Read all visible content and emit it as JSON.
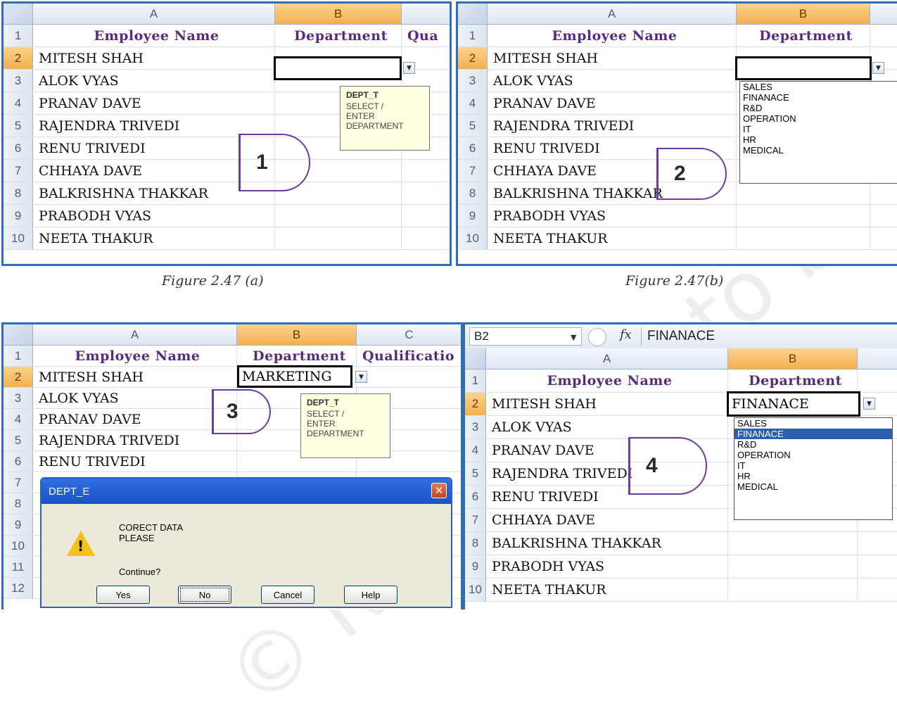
{
  "columns": {
    "a": "A",
    "b": "B",
    "c": "C"
  },
  "headers": {
    "employee_name": "Employee Name",
    "department": "Department",
    "qualification_a": "Qua",
    "qualification_c": "Qualificatio"
  },
  "row_numbers": [
    "1",
    "2",
    "3",
    "4",
    "5",
    "6",
    "7",
    "8",
    "9",
    "10",
    "11",
    "12"
  ],
  "employees": [
    "MITESH SHAH",
    "ALOK VYAS",
    "PRANAV DAVE",
    "RAJENDRA TRIVEDI",
    "RENU TRIVEDI",
    "CHHAYA DAVE",
    "BALKRISHNA THAKKAR",
    "PRABODH VYAS",
    "NEETA THAKUR"
  ],
  "tooltip": {
    "title": "DEPT_T",
    "line1": "SELECT /",
    "line2": "ENTER",
    "line3": "DEPARTMENT"
  },
  "dropdown_options": [
    "SALES",
    "FINANACE",
    "R&D",
    "OPERATION",
    "IT",
    "HR",
    "MEDICAL"
  ],
  "panel3": {
    "cell_value": "MARKETING",
    "partial_row6": "RENU TRIVEDI"
  },
  "dialog": {
    "title": "DEPT_E",
    "message1": "CORECT DATA",
    "message2": "PLEASE",
    "question": "Continue?",
    "buttons": {
      "yes": "Yes",
      "no": "No",
      "cancel": "Cancel",
      "help": "Help"
    }
  },
  "panel4": {
    "name_box": "B2",
    "fx": "fx",
    "formula_value": "FINANACE",
    "cell_value": "FINANACE",
    "selected_option": "FINANACE",
    "partial_row10": "NEETA THAKUR"
  },
  "steps": {
    "s1": "1",
    "s2": "2",
    "s3": "3",
    "s4": "4"
  },
  "captions": {
    "a": "Figure 2.47 (a)",
    "b": "Figure 2.47(b)"
  },
  "watermark": "© NCERT not to be republished",
  "colors": {
    "panel_border": "#2f6fb7",
    "header_text": "#5a2a7a",
    "selected_header": "#f4b04f",
    "highlight": "#2c5fad",
    "tooltip_bg": "#ffffe1"
  }
}
